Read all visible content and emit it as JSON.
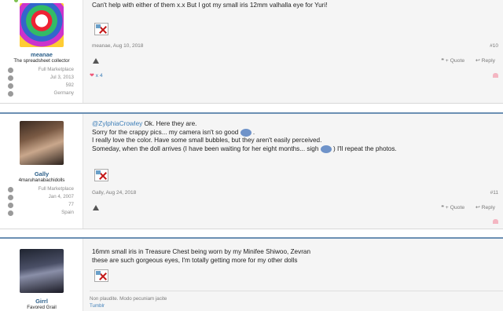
{
  "posts": [
    {
      "user": {
        "name": "meanae",
        "title": "The spreadsheet collector",
        "info": [
          {
            "icon": "marketplace-icon",
            "value": "Full Marketplace"
          },
          {
            "icon": "calendar-icon",
            "value": "Jul 3, 2013"
          },
          {
            "icon": "messages-icon",
            "value": "592"
          },
          {
            "icon": "location-icon",
            "value": "Germany"
          }
        ]
      },
      "body": [
        "Can't help with either of them x.x But I got my small iris 12mm valhalla eye for Yuri!"
      ],
      "meta": "meanae, Aug 10, 2018",
      "number": "#10",
      "quote_label": "+ Quote",
      "reply_label": "Reply",
      "likes": "x 4"
    },
    {
      "user": {
        "name": "Gally",
        "title": "4maruhanabachidolls",
        "info": [
          {
            "icon": "marketplace-icon",
            "value": "Full Marketplace"
          },
          {
            "icon": "calendar-icon",
            "value": "Jan 4, 2007"
          },
          {
            "icon": "messages-icon",
            "value": "77"
          },
          {
            "icon": "location-icon",
            "value": "Spain"
          }
        ]
      },
      "mention": "@ZylphiaCrowley",
      "line1_rest": " Ok. Here they are.",
      "line2": "Sorry for the crappy pics... my camera isn't so good",
      "line3": "I really love the color. Have some small bubbles, but they aren't easily perceived.",
      "line4a": "Someday, when the doll arrives (I have been waiting for her eight months... sigh",
      "line4b": ") I'll repeat the photos.",
      "meta": "Gally, Aug 24, 2018",
      "number": "#11",
      "quote_label": "+ Quote",
      "reply_label": "Reply"
    },
    {
      "user": {
        "name": "Girrl",
        "title": "Favored Grail"
      },
      "line1": "16mm small iris in Treasure Chest being worn by my Minifee Shiwoo, Zevran",
      "line2": "these are such gorgeous eyes, I'm totally getting more for my other dolls",
      "sig_line1": "Non plaudite. Modo pecuniam jacite",
      "sig_line2": "Tumblr"
    }
  ]
}
